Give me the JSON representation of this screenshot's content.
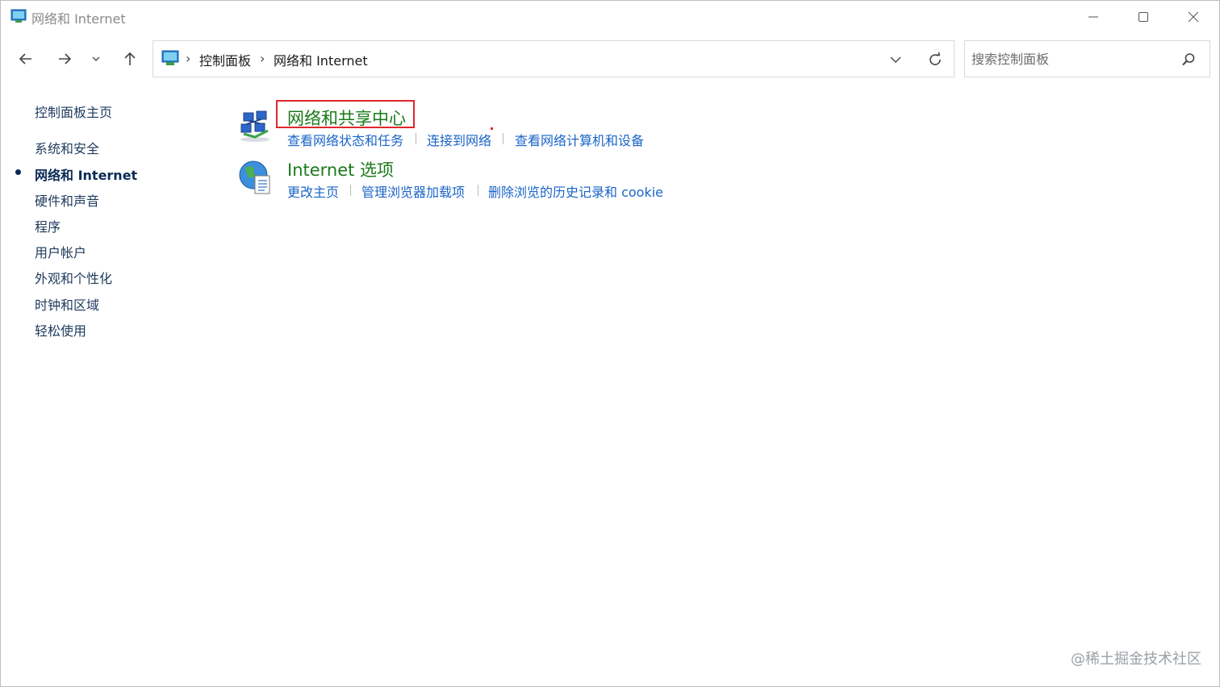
{
  "window": {
    "title": "网络和 Internet"
  },
  "nav": {
    "back_icon": "arrow-left-icon",
    "forward_icon": "arrow-right-icon",
    "recent_icon": "chevron-down-icon",
    "up_icon": "arrow-up-icon"
  },
  "address": {
    "crumbs": [
      "控制面板",
      "网络和 Internet"
    ],
    "separator": "›"
  },
  "search": {
    "placeholder": "搜索控制面板"
  },
  "sidebar": {
    "items": [
      {
        "label": "控制面板主页"
      },
      {
        "label": "系统和安全"
      },
      {
        "label": "网络和 Internet",
        "active": true
      },
      {
        "label": "硬件和声音"
      },
      {
        "label": "程序"
      },
      {
        "label": "用户帐户"
      },
      {
        "label": "外观和个性化"
      },
      {
        "label": "时钟和区域"
      },
      {
        "label": "轻松使用"
      }
    ]
  },
  "categories": [
    {
      "title": "网络和共享中心",
      "icon": "network-sharing-center-icon",
      "links": [
        "查看网络状态和任务",
        "连接到网络",
        "查看网络计算机和设备"
      ]
    },
    {
      "title": "Internet 选项",
      "icon": "internet-options-icon",
      "links": [
        "更改主页",
        "管理浏览器加载项",
        "删除浏览的历史记录和 cookie"
      ]
    }
  ],
  "watermark": "@稀土掘金技术社区",
  "colors": {
    "category_title": "#1a7a1a",
    "link": "#1a64c8",
    "highlight": "#e0282e",
    "sidebar_text": "#1e3a5c"
  }
}
